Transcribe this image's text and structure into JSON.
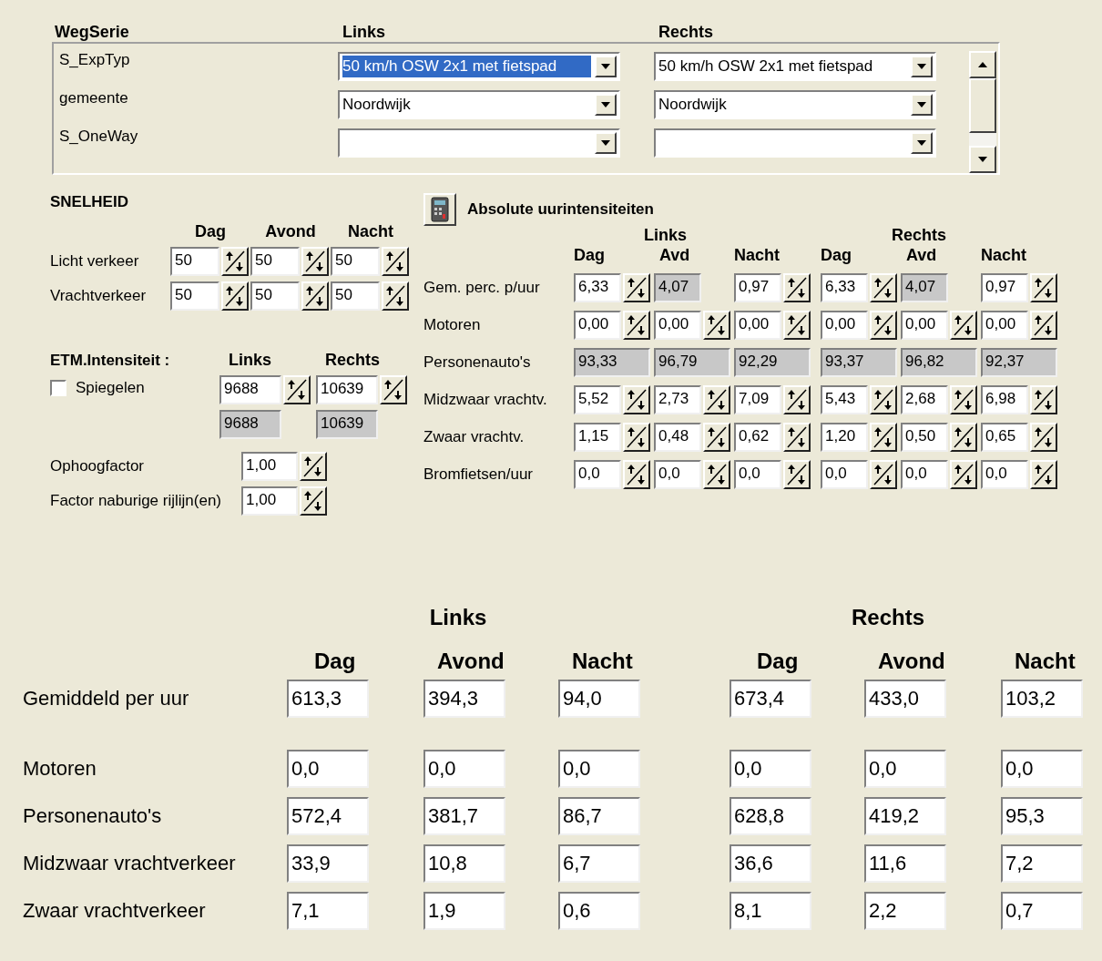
{
  "weg_serie": {
    "headers": [
      "WegSerie",
      "Links",
      "Rechts"
    ],
    "rows": [
      {
        "label": "S_ExpTyp",
        "links": {
          "value": "50 km/h OSW 2x1 met fietspad",
          "selected": true
        },
        "rechts": {
          "value": "50 km/h OSW 2x1 met fietspad",
          "selected": false
        }
      },
      {
        "label": "gemeente",
        "links": {
          "value": "Noordwijk",
          "selected": false
        },
        "rechts": {
          "value": "Noordwijk",
          "selected": false
        }
      },
      {
        "label": "S_OneWay",
        "links": {
          "selected": false
        },
        "rechts": {
          "selected": false
        }
      }
    ]
  },
  "snelheid": {
    "title": "SNELHEID",
    "columns": [
      "Dag",
      "Avond",
      "Nacht"
    ],
    "rows": [
      {
        "label": "Licht verkeer",
        "values": [
          "50",
          "50",
          "50"
        ]
      },
      {
        "label": "Vrachtverkeer",
        "values": [
          "50",
          "50",
          "50"
        ]
      }
    ]
  },
  "etm": {
    "title": "ETM.Intensiteit :",
    "columns": [
      "Links",
      "Rechts"
    ],
    "spiegelen": {
      "label": "Spiegelen",
      "checked": false
    },
    "inputs": [
      "9688",
      "10639"
    ],
    "computed": [
      "9688",
      "10639"
    ]
  },
  "factors": [
    {
      "label": "Ophoogfactor",
      "value": "1,00"
    },
    {
      "label": "Factor naburige rijlijn(en)",
      "value": "1,00"
    }
  ],
  "absolute": {
    "button": "Absolute uurintensiteiten",
    "groups": [
      "Links",
      "Rechts"
    ],
    "columns": [
      "Dag",
      "Avd",
      "Nacht",
      "Dag",
      "Avd",
      "Nacht"
    ],
    "rows": [
      {
        "label": "Gem. perc. p/uur",
        "cells": [
          {
            "value": "6,33",
            "kind": "spin"
          },
          {
            "value": "4,07",
            "kind": "locked"
          },
          {
            "value": "0,97",
            "kind": "spin"
          },
          {
            "value": "6,33",
            "kind": "spin"
          },
          {
            "value": "4,07",
            "kind": "locked"
          },
          {
            "value": "0,97",
            "kind": "spin"
          }
        ]
      },
      {
        "label": "Motoren",
        "cells": [
          {
            "value": "0,00",
            "kind": "spin"
          },
          {
            "value": "0,00",
            "kind": "spin"
          },
          {
            "value": "0,00",
            "kind": "spin"
          },
          {
            "value": "0,00",
            "kind": "spin"
          },
          {
            "value": "0,00",
            "kind": "spin"
          },
          {
            "value": "0,00",
            "kind": "spin"
          }
        ]
      },
      {
        "label": "Personenauto's",
        "cells": [
          {
            "value": "93,33",
            "kind": "sum"
          },
          {
            "value": "96,79",
            "kind": "sum"
          },
          {
            "value": "92,29",
            "kind": "sum"
          },
          {
            "value": "93,37",
            "kind": "sum"
          },
          {
            "value": "96,82",
            "kind": "sum"
          },
          {
            "value": "92,37",
            "kind": "sum"
          }
        ]
      },
      {
        "label": "Midzwaar vrachtv.",
        "cells": [
          {
            "value": "5,52",
            "kind": "spin"
          },
          {
            "value": "2,73",
            "kind": "spin"
          },
          {
            "value": "7,09",
            "kind": "spin"
          },
          {
            "value": "5,43",
            "kind": "spin"
          },
          {
            "value": "2,68",
            "kind": "spin"
          },
          {
            "value": "6,98",
            "kind": "spin"
          }
        ]
      },
      {
        "label": "Zwaar vrachtv.",
        "cells": [
          {
            "value": "1,15",
            "kind": "spin"
          },
          {
            "value": "0,48",
            "kind": "spin"
          },
          {
            "value": "0,62",
            "kind": "spin"
          },
          {
            "value": "1,20",
            "kind": "spin"
          },
          {
            "value": "0,50",
            "kind": "spin"
          },
          {
            "value": "0,65",
            "kind": "spin"
          }
        ]
      },
      {
        "label": "Bromfietsen/uur",
        "cells": [
          {
            "value": "0,0",
            "kind": "spin"
          },
          {
            "value": "0,0",
            "kind": "spin"
          },
          {
            "value": "0,0",
            "kind": "spin"
          },
          {
            "value": "0,0",
            "kind": "spin"
          },
          {
            "value": "0,0",
            "kind": "spin"
          },
          {
            "value": "0,0",
            "kind": "spin"
          }
        ]
      }
    ]
  },
  "results": {
    "groups": [
      "Links",
      "Rechts"
    ],
    "columns": [
      "Dag",
      "Avond",
      "Nacht",
      "Dag",
      "Avond",
      "Nacht"
    ],
    "rows": [
      {
        "label": "Gemiddeld per uur",
        "values": [
          "613,3",
          "394,3",
          "94,0",
          "673,4",
          "433,0",
          "103,2"
        ]
      },
      {
        "label": "Motoren",
        "values": [
          "0,0",
          "0,0",
          "0,0",
          "0,0",
          "0,0",
          "0,0"
        ]
      },
      {
        "label": "Personenauto's",
        "values": [
          "572,4",
          "381,7",
          "86,7",
          "628,8",
          "419,2",
          "95,3"
        ]
      },
      {
        "label": "Midzwaar vrachtverkeer",
        "values": [
          "33,9",
          "10,8",
          "6,7",
          "36,6",
          "11,6",
          "7,2"
        ]
      },
      {
        "label": "Zwaar vrachtverkeer",
        "values": [
          "7,1",
          "1,9",
          "0,6",
          "8,1",
          "2,2",
          "0,7"
        ]
      }
    ]
  }
}
